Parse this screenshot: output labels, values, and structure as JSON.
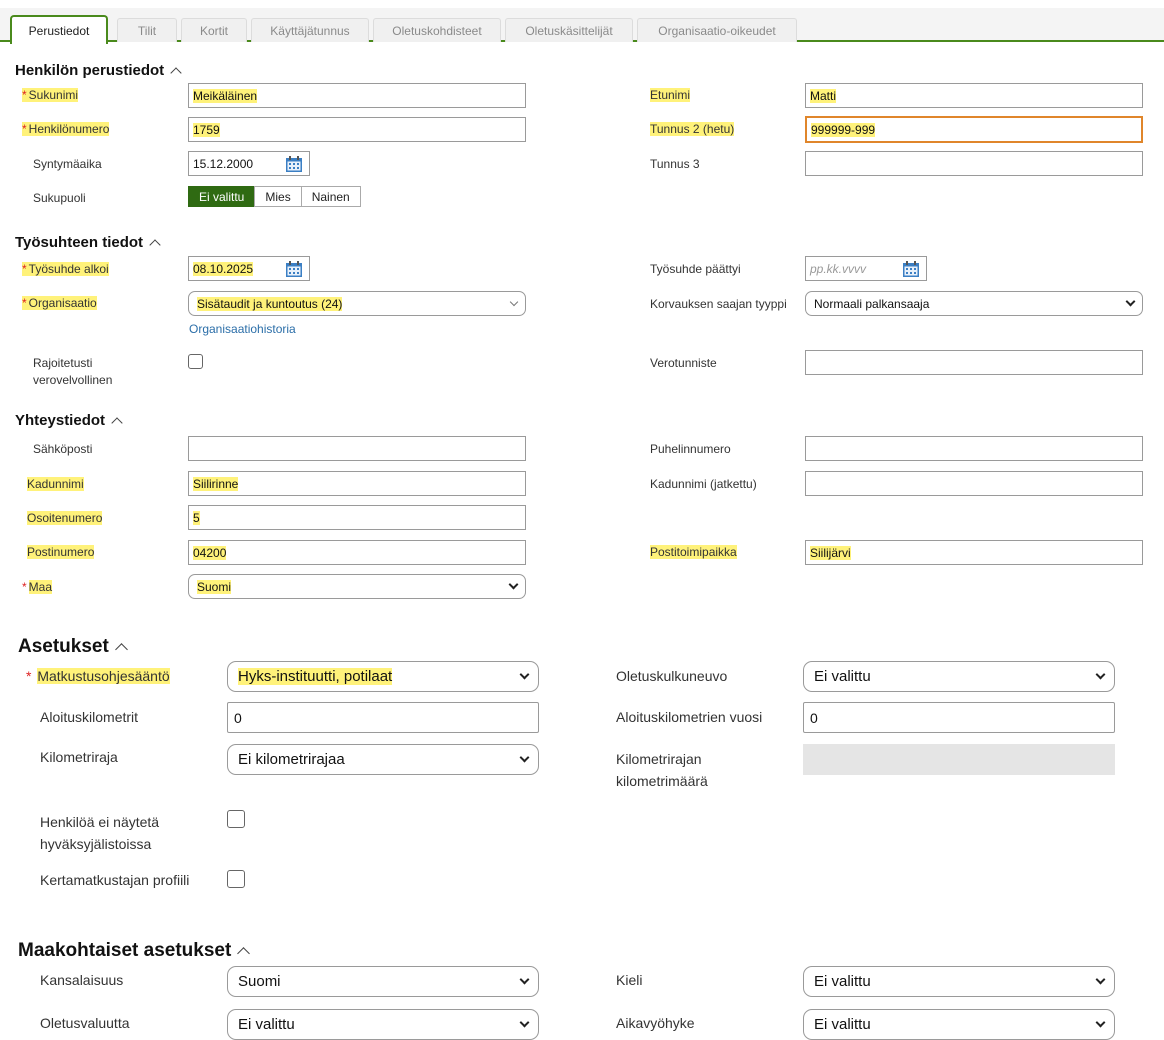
{
  "tabs": [
    "Perustiedot",
    "Tilit",
    "Kortit",
    "Käyttäjätunnus",
    "Oletuskohdisteet",
    "Oletuskäsittelijät",
    "Organisaatio-oikeudet"
  ],
  "required_marker": "*",
  "sections": {
    "basic": "Henkilön perustiedot",
    "employment": "Työsuhteen tiedot",
    "contact": "Yhteystiedot",
    "settings": "Asetukset",
    "country": "Maakohtaiset asetukset"
  },
  "basic": {
    "sukunimi_label": "Sukunimi",
    "sukunimi_value": "Meikäläinen",
    "etunimi_label": "Etunimi",
    "etunimi_value": "Matti",
    "henkilonumero_label": "Henkilönumero",
    "henkilonumero_value": "1759",
    "tunnus2_label": "Tunnus 2 (hetu)",
    "tunnus2_value": "999999-999",
    "syntymaaika_label": "Syntymäaika",
    "syntymaaika_value": "15.12.2000",
    "tunnus3_label": "Tunnus 3",
    "tunnus3_value": "",
    "sukupuoli_label": "Sukupuoli",
    "sukupuoli_options": [
      "Ei valittu",
      "Mies",
      "Nainen"
    ],
    "sukupuoli_selected": "Ei valittu"
  },
  "employment": {
    "alkoi_label": "Työsuhde alkoi",
    "alkoi_value": "08.10.2025",
    "paattyi_label": "Työsuhde päättyi",
    "paattyi_placeholder": "pp.kk.vvvv",
    "organisaatio_label": "Organisaatio",
    "organisaatio_value": "Sisätaudit ja kuntoutus (24)",
    "org_history_link": "Organisaatiohistoria",
    "korvaus_label": "Korvauksen saajan tyyppi",
    "korvaus_value": "Normaali palkansaaja",
    "rajoitetusti_label_1": "Rajoitetusti",
    "rajoitetusti_label_2": "verovelvollinen",
    "verotunniste_label": "Verotunniste",
    "verotunniste_value": ""
  },
  "contact": {
    "sahkoposti_label": "Sähköposti",
    "sahkoposti_value": "",
    "puhelin_label": "Puhelinnumero",
    "puhelin_value": "",
    "kadunnimi_label": "Kadunnimi",
    "kadunnimi_value": "Siilirinne",
    "kadunnimi2_label": "Kadunnimi (jatkettu)",
    "kadunnimi2_value": "",
    "osoitenumero_label": "Osoitenumero",
    "osoitenumero_value": "5",
    "postinumero_label": "Postinumero",
    "postinumero_value": "04200",
    "postitoimipaikka_label": "Postitoimipaikka",
    "postitoimipaikka_value": "Siilijärvi",
    "maa_label": "Maa",
    "maa_value": "Suomi"
  },
  "settings": {
    "matkustus_label": "Matkustusohjesääntö",
    "matkustus_value": "Hyks-instituutti, potilaat",
    "kulkuneuvo_label": "Oletuskulkuneuvo",
    "kulkuneuvo_value": "Ei valittu",
    "aloitus_km_label": "Aloituskilometrit",
    "aloitus_km_value": "0",
    "aloitus_vuosi_label": "Aloituskilometrien vuosi",
    "aloitus_vuosi_value": "0",
    "km_raja_label": "Kilometriraja",
    "km_raja_value": "Ei kilometrirajaa",
    "km_maara_label_1": "Kilometrirajan",
    "km_maara_label_2": "kilometrimäärä",
    "ei_nayteta_label_1": "Henkilöä ei näytetä",
    "ei_nayteta_label_2": "hyväksyjälistoissa",
    "kertamatkustaja_label": "Kertamatkustajan profiili"
  },
  "country": {
    "kansalaisuus_label": "Kansalaisuus",
    "kansalaisuus_value": "Suomi",
    "kieli_label": "Kieli",
    "kieli_value": "Ei valittu",
    "valuutta_label": "Oletusvaluutta",
    "valuutta_value": "Ei valittu",
    "aikavyohyke_label": "Aikavyöhyke",
    "aikavyohyke_value": "Ei valittu"
  },
  "colors": {
    "accent_green": "#4a8a1c",
    "highlight": "#fff27a",
    "required": "#dd2222",
    "link": "#2b6ea8",
    "focus_border": "#e0862b"
  }
}
